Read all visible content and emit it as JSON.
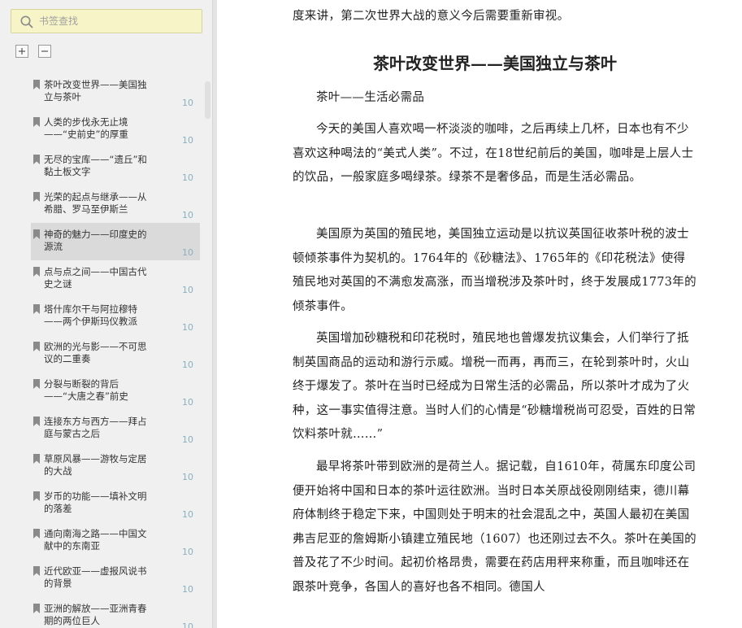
{
  "sidebar": {
    "search_placeholder": "书签查找",
    "items": [
      {
        "title": "茶叶改变世界——美国独立与茶叶",
        "page": "10"
      },
      {
        "title": "人类的步伐永无止境——“史前史”的厚重",
        "page": "10"
      },
      {
        "title": "无尽的宝库——“遗丘”和黏土板文字",
        "page": "10"
      },
      {
        "title": "光荣的起点与继承——从希腊、罗马至伊斯兰",
        "page": "10"
      },
      {
        "title": "神奇的魅力——印度史的源流",
        "page": "10"
      },
      {
        "title": "点与点之间——中国古代史之谜",
        "page": "10"
      },
      {
        "title": "塔什库尔干与阿拉穆特——两个伊斯玛仪教派",
        "page": "10"
      },
      {
        "title": "欧洲的光与影——不可思议的二重奏",
        "page": "10"
      },
      {
        "title": "分裂与断裂的背后——“大唐之春”前史",
        "page": "10"
      },
      {
        "title": "连接东方与西方——拜占庭与蒙古之后",
        "page": "10"
      },
      {
        "title": "草原风暴——游牧与定居的大战",
        "page": "10"
      },
      {
        "title": "岁币的功能——填补文明的落差",
        "page": "10"
      },
      {
        "title": "通向南海之路——中国文献中的东南亚",
        "page": "10"
      },
      {
        "title": "近代欧亚——虚报风说书的背景",
        "page": "10"
      },
      {
        "title": "亚洲的解放——亚洲青春期的两位巨人",
        "page": "10"
      }
    ],
    "active_index": 4
  },
  "reader": {
    "p0": "度来讲，第二次世界大战的意义今后需要重新审视。",
    "heading": "茶叶改变世界——美国独立与茶叶",
    "subheading": "茶叶——生活必需品",
    "p1": "今天的美国人喜欢喝一杯淡淡的咖啡，之后再续上几杯，日本也有不少喜欢这种喝法的“美式人类”。不过，在18世纪前后的美国，咖啡是上层人士的饮品，一般家庭多喝绿茶。绿茶不是奢侈品，而是生活必需品。",
    "p2": "美国原为英国的殖民地，美国独立运动是以抗议英国征收茶叶税的波士顿倾茶事件为契机的。1764年的《砂糖法》、1765年的《印花税法》使得殖民地对英国的不满愈发高涨，而当增税涉及茶叶时，终于发展成1773年的倾茶事件。",
    "p3": "英国增加砂糖税和印花税时，殖民地也曾爆发抗议集会，人们举行了抵制英国商品的运动和游行示威。增税一而再，再而三，在轮到茶叶时，火山终于爆发了。茶叶在当时已经成为日常生活的必需品，所以茶叶才成为了火种，这一事实值得注意。当时人们的心情是“砂糖增税尚可忍受，百姓的日常饮料茶叶就……”",
    "p4": "最早将茶叶带到欧洲的是荷兰人。据记载，自1610年，荷属东印度公司便开始将中国和日本的茶叶运往欧洲。当时日本关原战役刚刚结束，德川幕府体制终于稳定下来，中国则处于明末的社会混乱之中，英国人最初在美国弗吉尼亚的詹姆斯小镇建立殖民地（1607）也还刚过去不久。茶叶在美国的普及花了不少时间。起初价格昂贵，需要在药店用秤来称重，而且咖啡还在跟茶叶竞争，各国人的喜好也各不相同。德国人"
  }
}
